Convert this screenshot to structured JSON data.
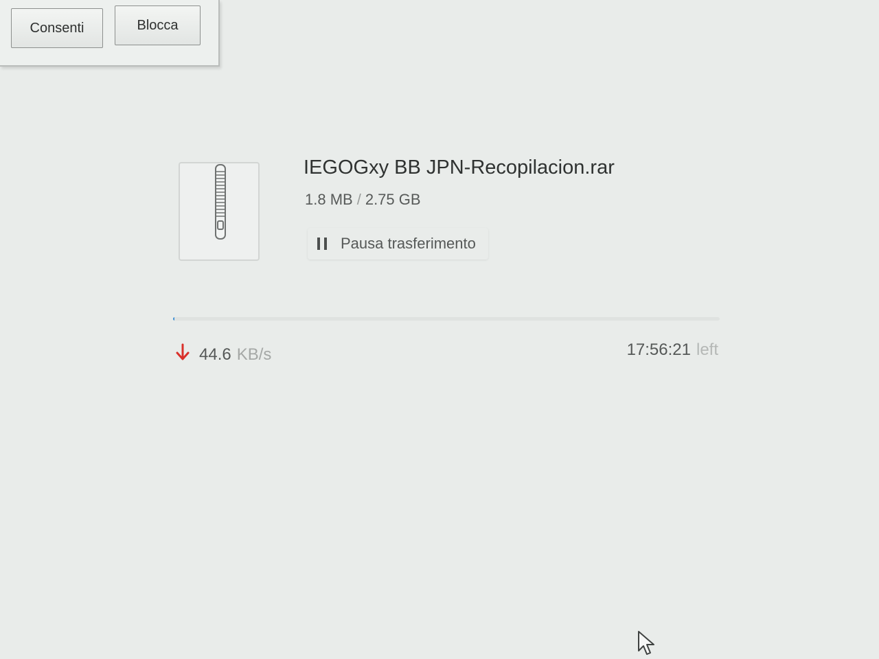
{
  "permission_bar": {
    "allow_label": "Consenti",
    "block_label": "Blocca"
  },
  "download": {
    "file_name": "IEGOGxy BB JPN-Recopilacion.rar",
    "downloaded": "1.8 MB",
    "separator": "/",
    "total": "2.75 GB",
    "pause_label": "Pausa trasferimento",
    "progress_fraction": 0.0007,
    "speed_value": "44.6",
    "speed_unit": "KB/s",
    "time_remaining": "17:56:21",
    "time_suffix": "left",
    "file_icon": "zip-archive-icon",
    "speed_icon": "download-arrow-icon"
  },
  "colors": {
    "background": "#e9ecea",
    "download_arrow": "#d9302a",
    "progress_accent": "#3d8fd6"
  }
}
